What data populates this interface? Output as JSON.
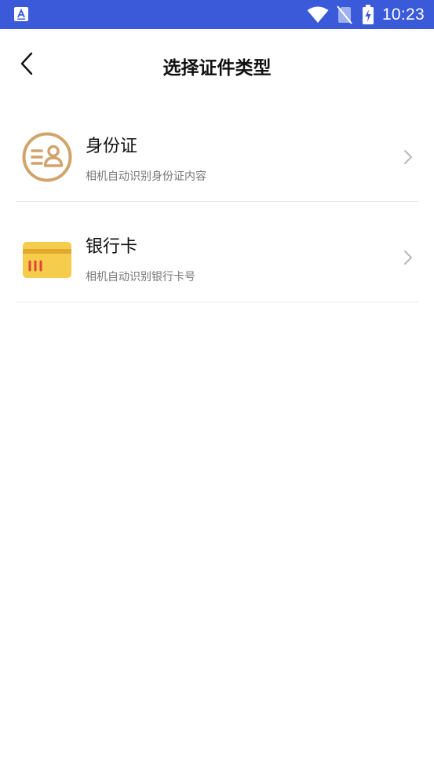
{
  "status_bar": {
    "time": "10:23",
    "background_color": "#3a5ad9",
    "icons": [
      "app-notification-icon",
      "wifi-icon",
      "no-sim-icon",
      "battery-charging-icon"
    ]
  },
  "header": {
    "title": "选择证件类型",
    "back_icon": "back-arrow-icon"
  },
  "items": [
    {
      "title": "身份证",
      "subtitle": "相机自动识别身份证内容",
      "icon": "id-card-icon",
      "icon_color": "#d0a46a"
    },
    {
      "title": "银行卡",
      "subtitle": "相机自动识别银行卡号",
      "icon": "bank-card-icon",
      "icon_color": "#f5cc4b"
    }
  ]
}
